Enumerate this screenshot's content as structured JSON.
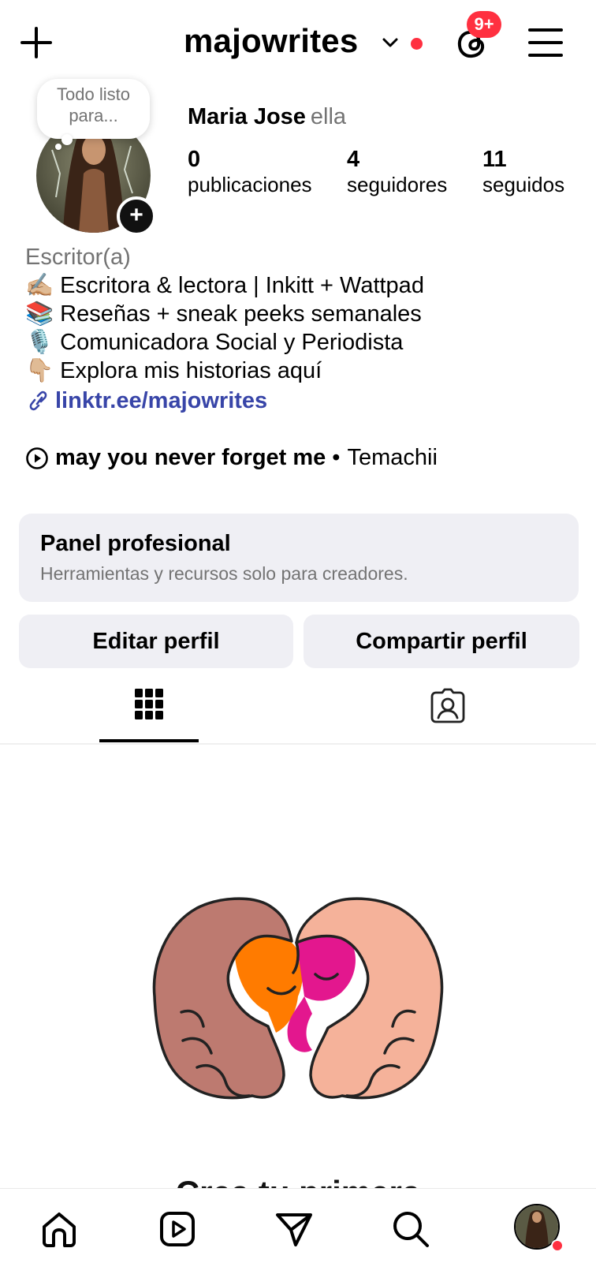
{
  "header": {
    "username": "majowrites",
    "notification_badge": "9+",
    "icons": [
      "plus-icon",
      "chevron-down-icon",
      "threads-icon",
      "menu-icon"
    ]
  },
  "note": {
    "text": "Todo listo para..."
  },
  "profile": {
    "name": "Maria Jose",
    "pronoun": "ella",
    "stats": [
      {
        "count": "0",
        "label": "publicaciones"
      },
      {
        "count": "4",
        "label": "seguidores"
      },
      {
        "count": "11",
        "label": "seguidos"
      }
    ]
  },
  "bio": {
    "category": "Escritor(a)",
    "lines": [
      "✍🏼 Escritora & lectora | Inkitt + Wattpad",
      "📚 Reseñas + sneak peeks semanales",
      "🎙️ Comunicadora Social y Periodista",
      "👇🏼 Explora mis historias aquí"
    ],
    "link": "linktr.ee/majowrites"
  },
  "music": {
    "song": "may you never forget me",
    "separator": "•",
    "artist": "Temachii"
  },
  "panel": {
    "title": "Panel profesional",
    "subtitle": "Herramientas y recursos solo para creadores."
  },
  "buttons": {
    "edit": "Editar perfil",
    "share": "Compartir perfil"
  },
  "tabs": [
    "grid-icon",
    "tagged-icon"
  ],
  "empty_state": {
    "title": "Crea tu primera"
  },
  "bottom_nav": [
    "home-icon",
    "reels-icon",
    "direct-icon",
    "search-icon",
    "profile-avatar"
  ],
  "colors": {
    "accent_red": "#ff3040",
    "link_blue": "#3845a8",
    "panel_bg": "#efeff4"
  }
}
